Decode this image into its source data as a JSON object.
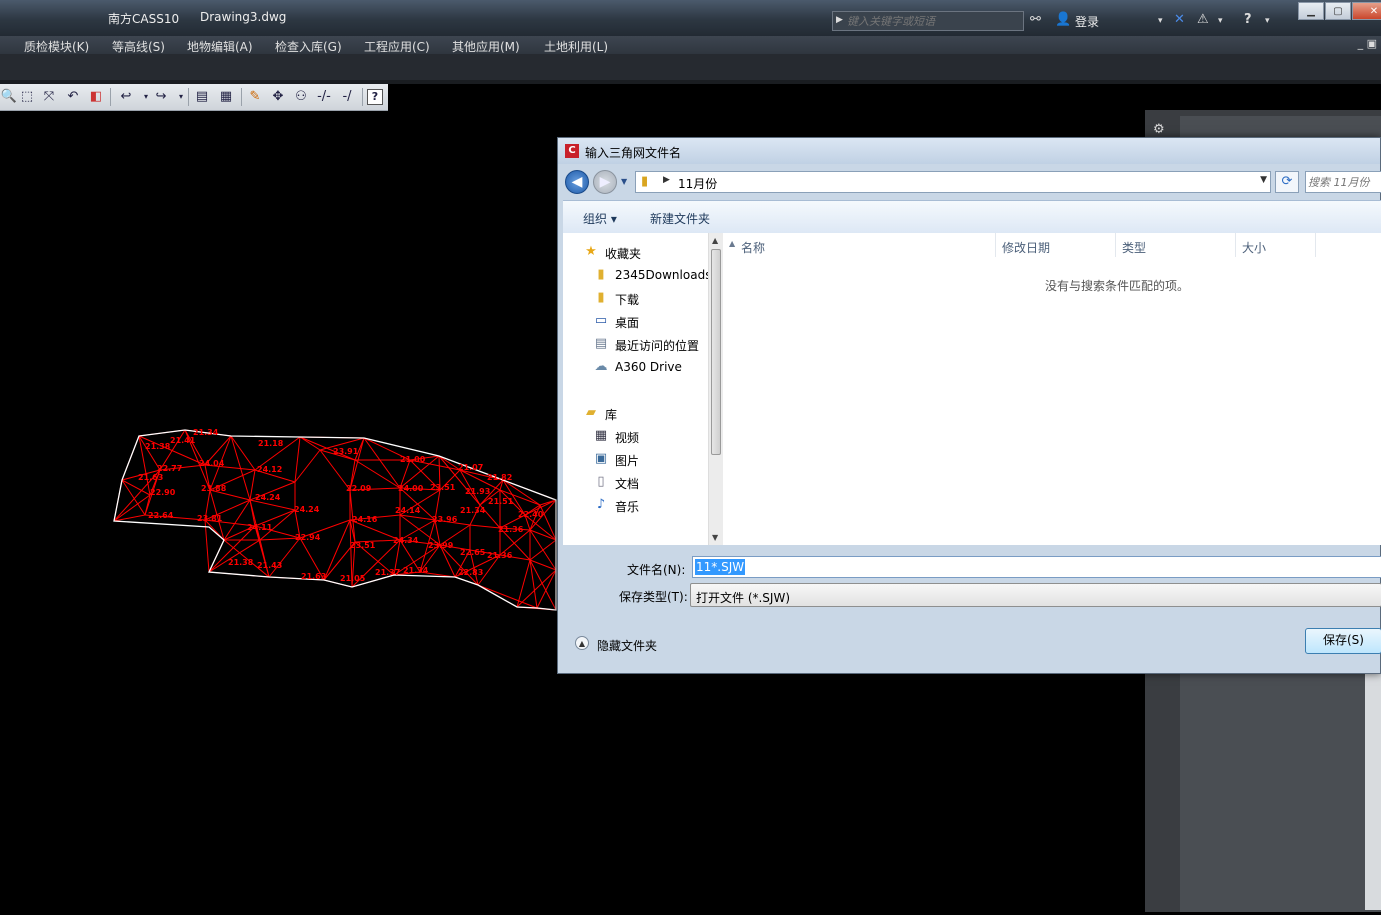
{
  "app": {
    "name": "南方CASS10",
    "document": "Drawing3.dwg",
    "search_placeholder": "键入关键字或短语",
    "login_label": "登录"
  },
  "menu": [
    "质检模块(K)",
    "等高线(S)",
    "地物编辑(A)",
    "检查入库(G)",
    "工程应用(C)",
    "其他应用(M)",
    "土地利用(L)"
  ],
  "toolbar_icons": [
    "zoom-icon",
    "zoom-window-icon",
    "zoom-extents-icon",
    "zoom-previous-icon",
    "layer-icon",
    "undo-icon",
    "redo-icon",
    "properties-icon",
    "design-center-icon",
    "pencil-icon",
    "move-icon",
    "group-icon",
    "trim-icon",
    "extend-icon",
    "help-icon"
  ],
  "drawing": {
    "labels": [
      "21.38",
      "21.41",
      "21.34",
      "21.18",
      "23.91",
      "21.63",
      "22.77",
      "24.04",
      "24.12",
      "21.00",
      "21.07",
      "21.82",
      "22.90",
      "23.88",
      "24.24",
      "22.09",
      "24.00",
      "23.51",
      "21.93",
      "22.64",
      "23.81",
      "24.24",
      "24.16",
      "24.14",
      "23.96",
      "21.34",
      "21.51",
      "22.40",
      "21.36",
      "24.11",
      "22.94",
      "23.51",
      "24.34",
      "23.99",
      "22.65",
      "21.36",
      "21.38",
      "21.43",
      "21.63",
      "21.05",
      "21.37",
      "21.34",
      "22.83"
    ]
  },
  "dialog": {
    "title": "输入三角网文件名",
    "path": "11月份",
    "search_placeholder": "搜索 11月份",
    "organize": "组织 ▾",
    "new_folder": "新建文件夹",
    "nav": [
      {
        "label": "收藏夹",
        "icon": "star-icon",
        "level": 0
      },
      {
        "label": "2345Downloads",
        "icon": "folder-icon",
        "level": 1
      },
      {
        "label": "下载",
        "icon": "download-folder-icon",
        "level": 1
      },
      {
        "label": "桌面",
        "icon": "desktop-icon",
        "level": 1
      },
      {
        "label": "最近访问的位置",
        "icon": "recent-places-icon",
        "level": 1
      },
      {
        "label": "A360 Drive",
        "icon": "cloud-drive-icon",
        "level": 1
      },
      {
        "label": "库",
        "icon": "library-icon",
        "level": 0
      },
      {
        "label": "视频",
        "icon": "video-icon",
        "level": 1
      },
      {
        "label": "图片",
        "icon": "picture-icon",
        "level": 1
      },
      {
        "label": "文档",
        "icon": "document-icon",
        "level": 1
      },
      {
        "label": "音乐",
        "icon": "music-icon",
        "level": 1
      }
    ],
    "columns": [
      "名称",
      "修改日期",
      "类型",
      "大小"
    ],
    "empty_message": "没有与搜索条件匹配的项。",
    "filename_label": "文件名(N):",
    "filename_value": "11*.SJW",
    "filetype_label": "保存类型(T):",
    "filetype_value": "打开文件 (*.SJW)",
    "hide_folders": "隐藏文件夹",
    "save_button": "保存(S)"
  },
  "colors": {
    "canvas_bg": "#000000",
    "mesh": "#ff0000",
    "boundary": "#ffffff",
    "selection": "#3399ff"
  }
}
